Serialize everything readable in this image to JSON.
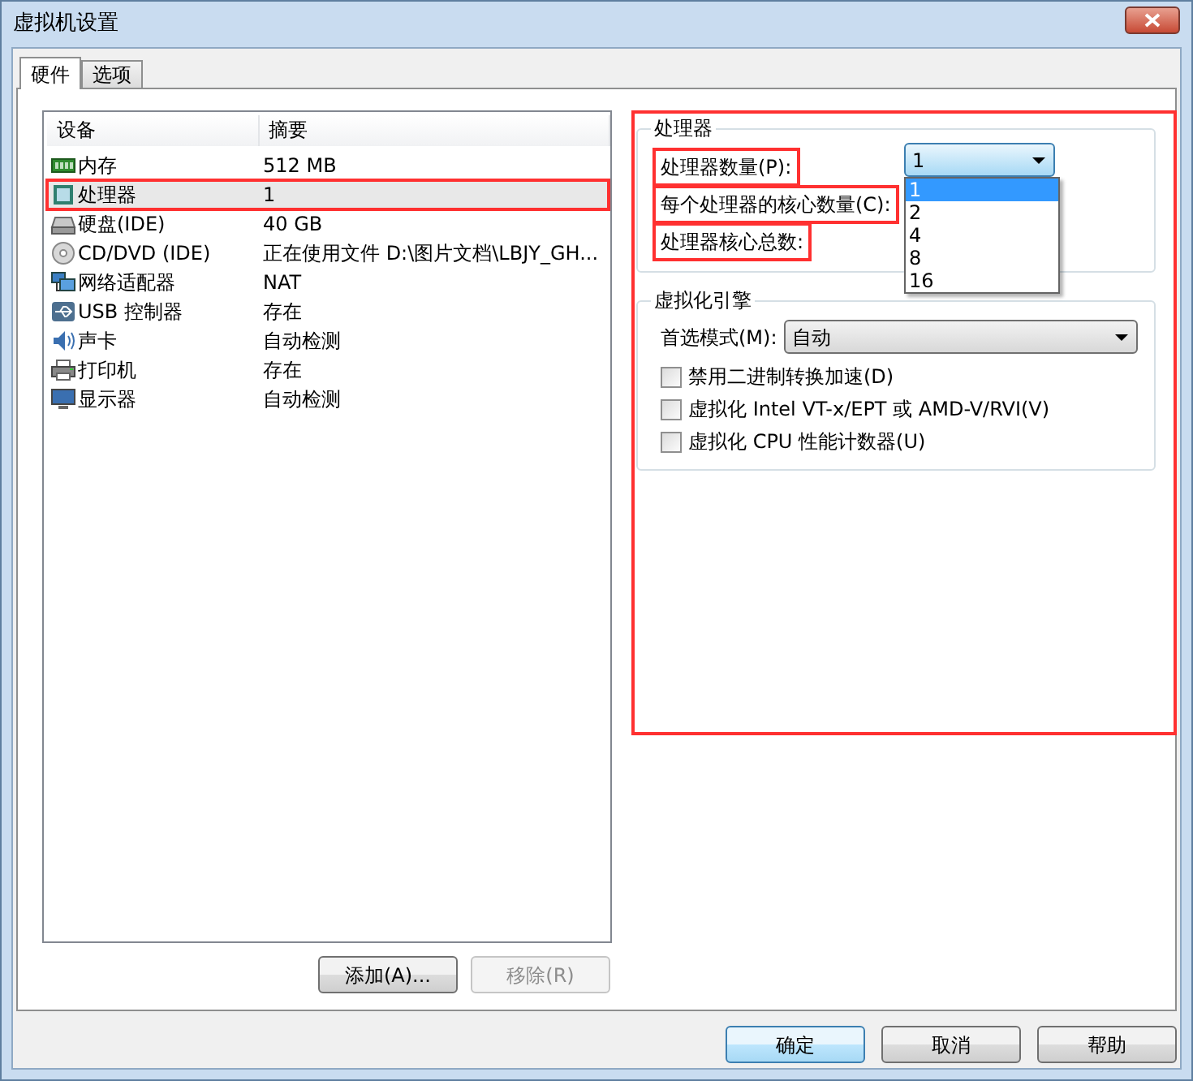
{
  "window": {
    "title": "虚拟机设置"
  },
  "tabs": [
    {
      "label": "硬件",
      "selected": true
    },
    {
      "label": "选项",
      "selected": false
    }
  ],
  "device_table": {
    "columns": [
      "设备",
      "摘要"
    ],
    "rows": [
      {
        "kind": "memory",
        "device": "内存",
        "summary": "512 MB",
        "selected": false,
        "highlighted": false
      },
      {
        "kind": "cpu",
        "device": "处理器",
        "summary": "1",
        "selected": true,
        "highlighted": true
      },
      {
        "kind": "disk",
        "device": "硬盘(IDE)",
        "summary": "40 GB",
        "selected": false,
        "highlighted": false
      },
      {
        "kind": "cd",
        "device": "CD/DVD (IDE)",
        "summary": "正在使用文件 D:\\图片文档\\LBJY_GH...",
        "selected": false,
        "highlighted": false
      },
      {
        "kind": "network",
        "device": "网络适配器",
        "summary": "NAT",
        "selected": false,
        "highlighted": false
      },
      {
        "kind": "usb",
        "device": "USB 控制器",
        "summary": "存在",
        "selected": false,
        "highlighted": false
      },
      {
        "kind": "sound",
        "device": "声卡",
        "summary": "自动检测",
        "selected": false,
        "highlighted": false
      },
      {
        "kind": "printer",
        "device": "打印机",
        "summary": "存在",
        "selected": false,
        "highlighted": false
      },
      {
        "kind": "display",
        "device": "显示器",
        "summary": "自动检测",
        "selected": false,
        "highlighted": false
      }
    ]
  },
  "device_buttons": [
    {
      "label": "添加(A)...",
      "disabled": false
    },
    {
      "label": "移除(R)",
      "disabled": true
    }
  ],
  "settings_panel": {
    "highlighted": true,
    "processor_group": {
      "title": "处理器",
      "fields": [
        {
          "label": "处理器数量(P):",
          "highlighted": true
        },
        {
          "label": "每个处理器的核心数量(C):",
          "highlighted": true
        },
        {
          "label": "处理器核心总数:",
          "highlighted": true
        }
      ],
      "count_select": {
        "value": "1",
        "open": true,
        "options": [
          {
            "label": "1",
            "selected": true
          },
          {
            "label": "2",
            "selected": false
          },
          {
            "label": "4",
            "selected": false
          },
          {
            "label": "8",
            "selected": false
          },
          {
            "label": "16",
            "selected": false
          }
        ]
      }
    },
    "virtualization_group": {
      "title": "虚拟化引擎",
      "mode_label": "首选模式(M):",
      "mode_value": "自动",
      "options": [
        {
          "label": "禁用二进制转换加速(D)",
          "checked": false
        },
        {
          "label": "虚拟化 Intel VT-x/EPT 或 AMD-V/RVI(V)",
          "checked": false
        },
        {
          "label": "虚拟化 CPU 性能计数器(U)",
          "checked": false
        }
      ]
    }
  },
  "dialog_buttons": [
    {
      "label": "确定",
      "default": true
    },
    {
      "label": "取消",
      "default": false
    },
    {
      "label": "帮助",
      "default": false
    }
  ]
}
